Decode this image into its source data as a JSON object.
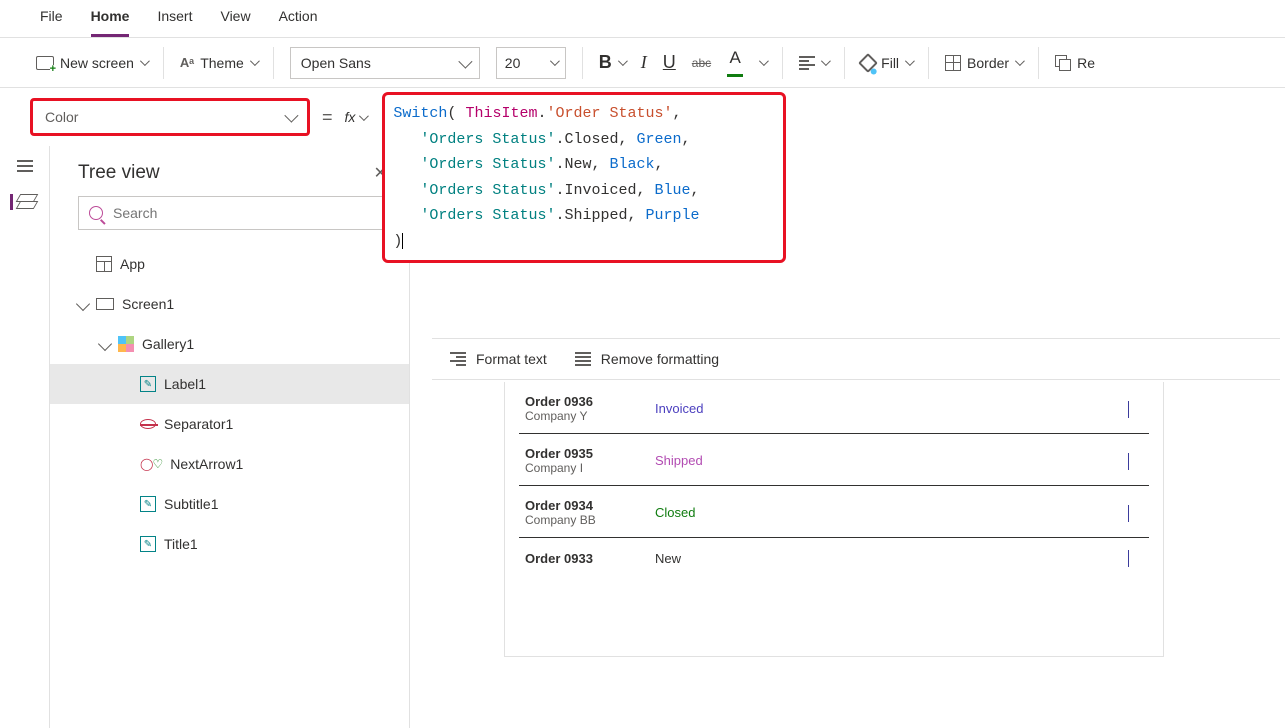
{
  "menubar": {
    "items": [
      "File",
      "Home",
      "Insert",
      "View",
      "Action"
    ],
    "active": "Home"
  },
  "toolbar": {
    "new_screen": "New screen",
    "theme": "Theme",
    "font_family": "Open Sans",
    "font_size": "20",
    "fill": "Fill",
    "border": "Border",
    "reorder": "Re"
  },
  "property": {
    "name": "Color"
  },
  "formula_bar": {
    "fx_label": "fx",
    "tokens": {
      "switch": "Switch",
      "thisitem": "ThisItem",
      "order_status_field": "'Order Status'",
      "orders_status_enum": "'Orders Status'",
      "closed": "Closed",
      "new": "New",
      "invoiced": "Invoiced",
      "shipped": "Shipped",
      "green": "Green",
      "black": "Black",
      "blue": "Blue",
      "purple": "Purple"
    },
    "format_text": "Format text",
    "remove_formatting": "Remove formatting"
  },
  "treeview": {
    "title": "Tree view",
    "search_placeholder": "Search",
    "app": "App",
    "screen": "Screen1",
    "gallery": "Gallery1",
    "items": [
      "Label1",
      "Separator1",
      "NextArrow1",
      "Subtitle1",
      "Title1"
    ],
    "selected": "Label1"
  },
  "orders": [
    {
      "title": "Order 0936",
      "subtitle": "Company Y",
      "status": "Invoiced",
      "status_class": "st-invoiced"
    },
    {
      "title": "Order 0935",
      "subtitle": "Company I",
      "status": "Shipped",
      "status_class": "st-shipped"
    },
    {
      "title": "Order 0934",
      "subtitle": "Company BB",
      "status": "Closed",
      "status_class": "st-closed"
    },
    {
      "title": "Order 0933",
      "subtitle": "",
      "status": "New",
      "status_class": "st-new"
    }
  ]
}
